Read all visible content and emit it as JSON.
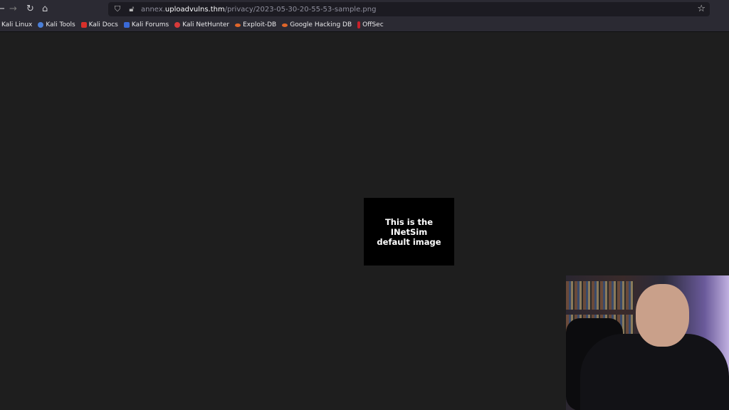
{
  "toolbar": {
    "back": "←",
    "forward": "→",
    "reload": "↻",
    "home": "⌂"
  },
  "url": {
    "prefix": "annex.",
    "host": "uploadvulns.thm",
    "path": "/privacy/2023-05-30-20-55-53-sample.png"
  },
  "bookmarks": [
    {
      "label": "Kali Linux",
      "color": "#2b2a33"
    },
    {
      "label": "Kali Tools",
      "color": "#4a7fd8"
    },
    {
      "label": "Kali Docs",
      "color": "#d8302a"
    },
    {
      "label": "Kali Forums",
      "color": "#3a6ad8"
    },
    {
      "label": "Kali NetHunter",
      "color": "#d83a3a"
    },
    {
      "label": "Exploit-DB",
      "color": "#e0662a"
    },
    {
      "label": "Google Hacking DB",
      "color": "#e0662a"
    },
    {
      "label": "OffSec",
      "color": "#c8202a"
    }
  ],
  "image": {
    "text": "This is the\nINetSim\ndefault image"
  }
}
